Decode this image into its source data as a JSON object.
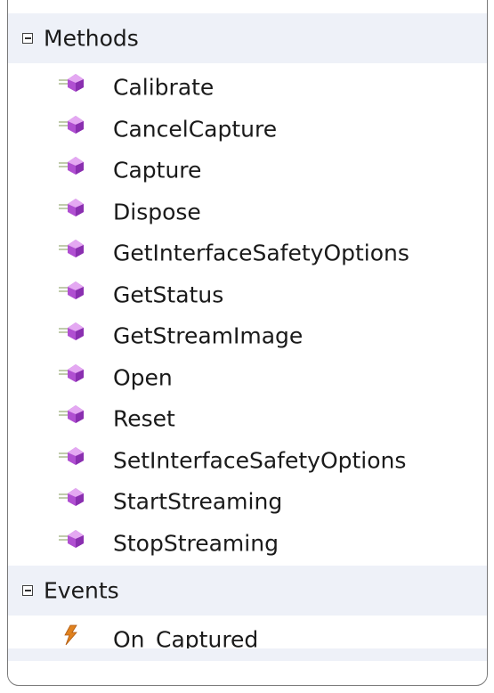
{
  "methods": {
    "title": "Methods",
    "items": [
      {
        "label": "Calibrate"
      },
      {
        "label": "CancelCapture"
      },
      {
        "label": "Capture"
      },
      {
        "label": "Dispose"
      },
      {
        "label": "GetInterfaceSafetyOptions"
      },
      {
        "label": "GetStatus"
      },
      {
        "label": "GetStreamImage"
      },
      {
        "label": "Open"
      },
      {
        "label": "Reset"
      },
      {
        "label": "SetInterfaceSafetyOptions"
      },
      {
        "label": "StartStreaming"
      },
      {
        "label": "StopStreaming"
      }
    ],
    "icon": "method-icon"
  },
  "events": {
    "title": "Events",
    "items": [
      {
        "label": "On_Captured"
      }
    ],
    "icon": "event-lightning-icon"
  },
  "colors": {
    "header_bg": "#eef1f8",
    "border": "#7a7a7a",
    "method_icon": "#b04fd1",
    "event_icon": "#e0821f"
  }
}
